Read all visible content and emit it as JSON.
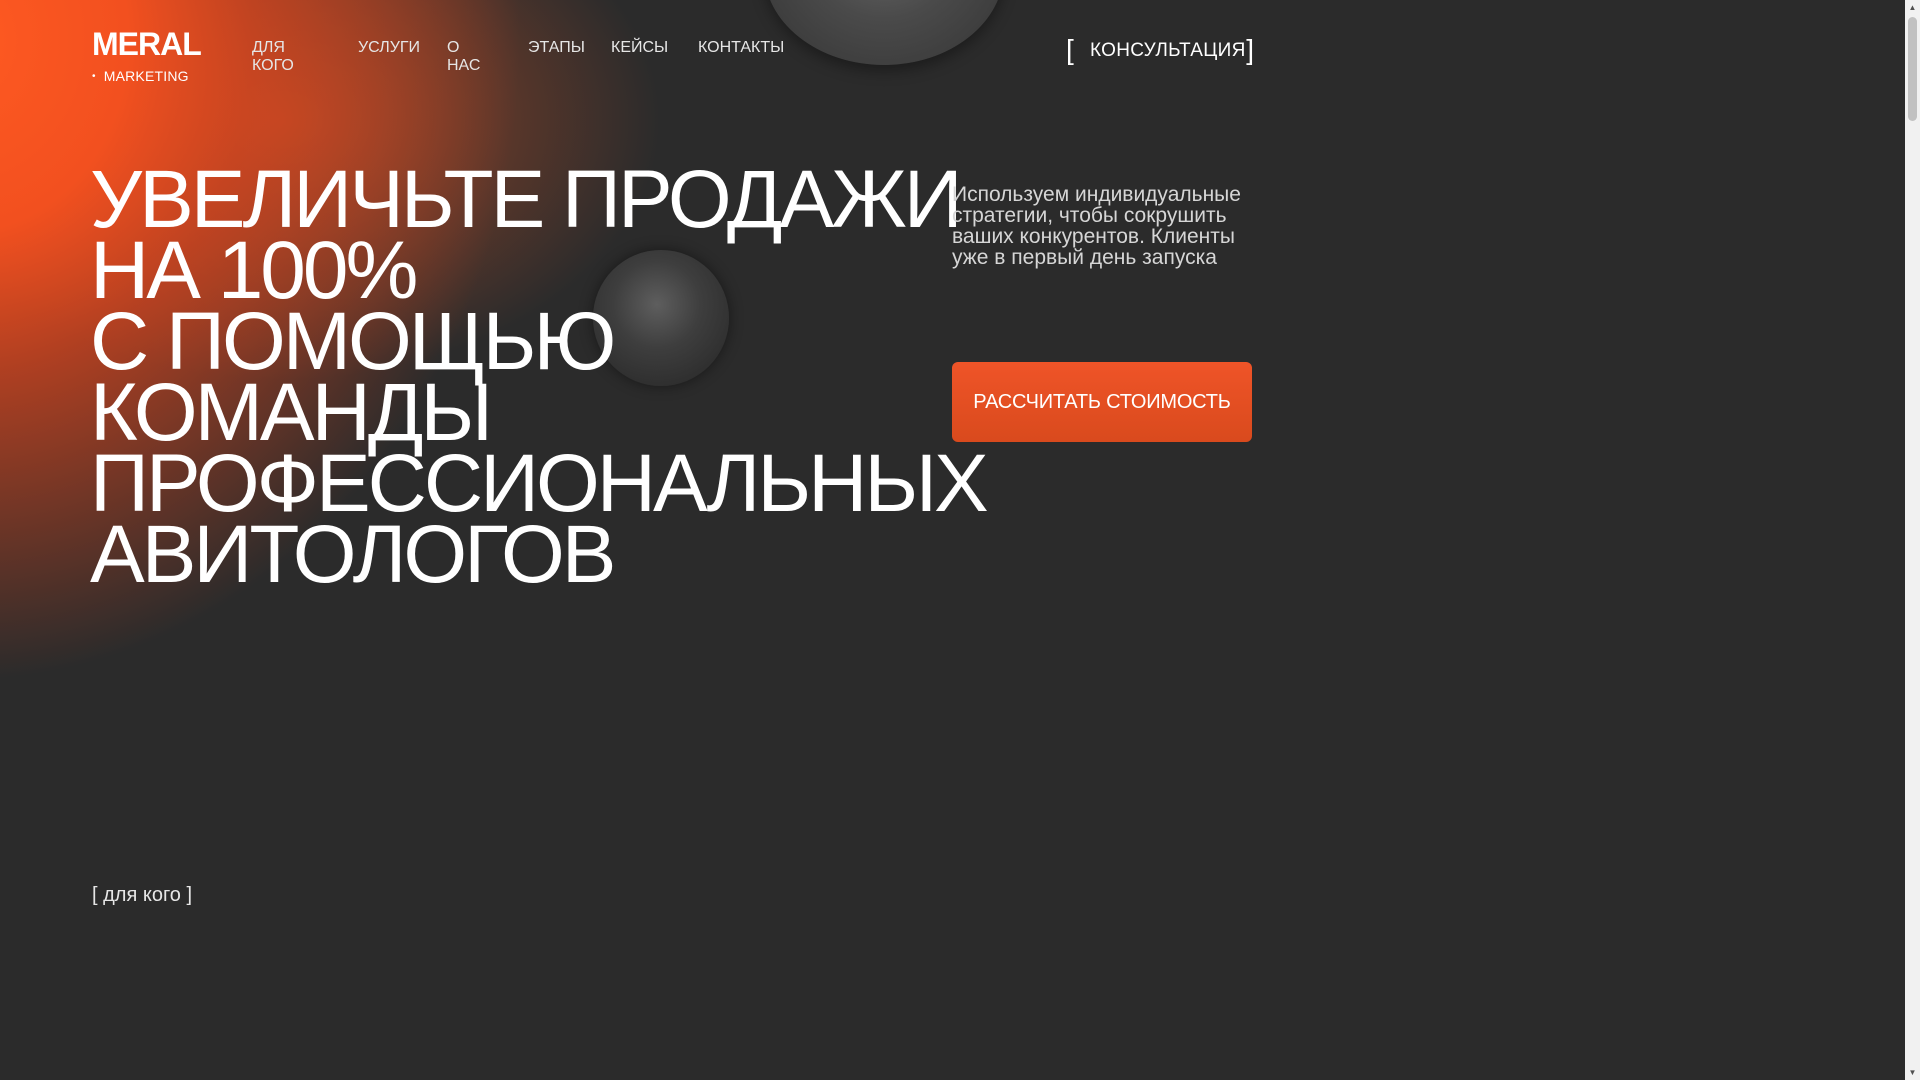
{
  "header": {
    "logo_main": "MERAL",
    "logo_sub": "MARKETING",
    "logo_dot": "•",
    "nav": [
      {
        "label": "ДЛЯ КОГО"
      },
      {
        "label": "УСЛУГИ"
      },
      {
        "label": "О НАС"
      },
      {
        "label": "ЭТАПЫ"
      },
      {
        "label": "КЕЙСЫ"
      },
      {
        "label": "КОНТАКТЫ"
      }
    ],
    "consult": {
      "bracket_left": "[",
      "label": "КОНСУЛЬТАЦИЯ",
      "bracket_right": "]"
    }
  },
  "hero": {
    "title_lines": [
      "УВЕЛИЧЬТЕ ПРОДАЖИ",
      "НА 100%",
      "С ПОМОЩЬЮ",
      "КОМАНДЫ",
      "ПРОФЕССИОНАЛЬНЫХ",
      "АВИТОЛОГОВ"
    ],
    "description": "Используем индивидуальные стратегии, чтобы сокрушить ваших конкурентов. Клиенты уже в первый день запуска",
    "cta_label": "РАССЧИТАТЬ СТОИМОСТЬ"
  },
  "section_tag": "[ для кого ]",
  "scrollbar": {
    "up_arrow": "▲",
    "down_arrow": "▼"
  },
  "colors": {
    "background": "#2b2b2b",
    "accent": "#ef5428",
    "glow": "#ff5a22"
  }
}
